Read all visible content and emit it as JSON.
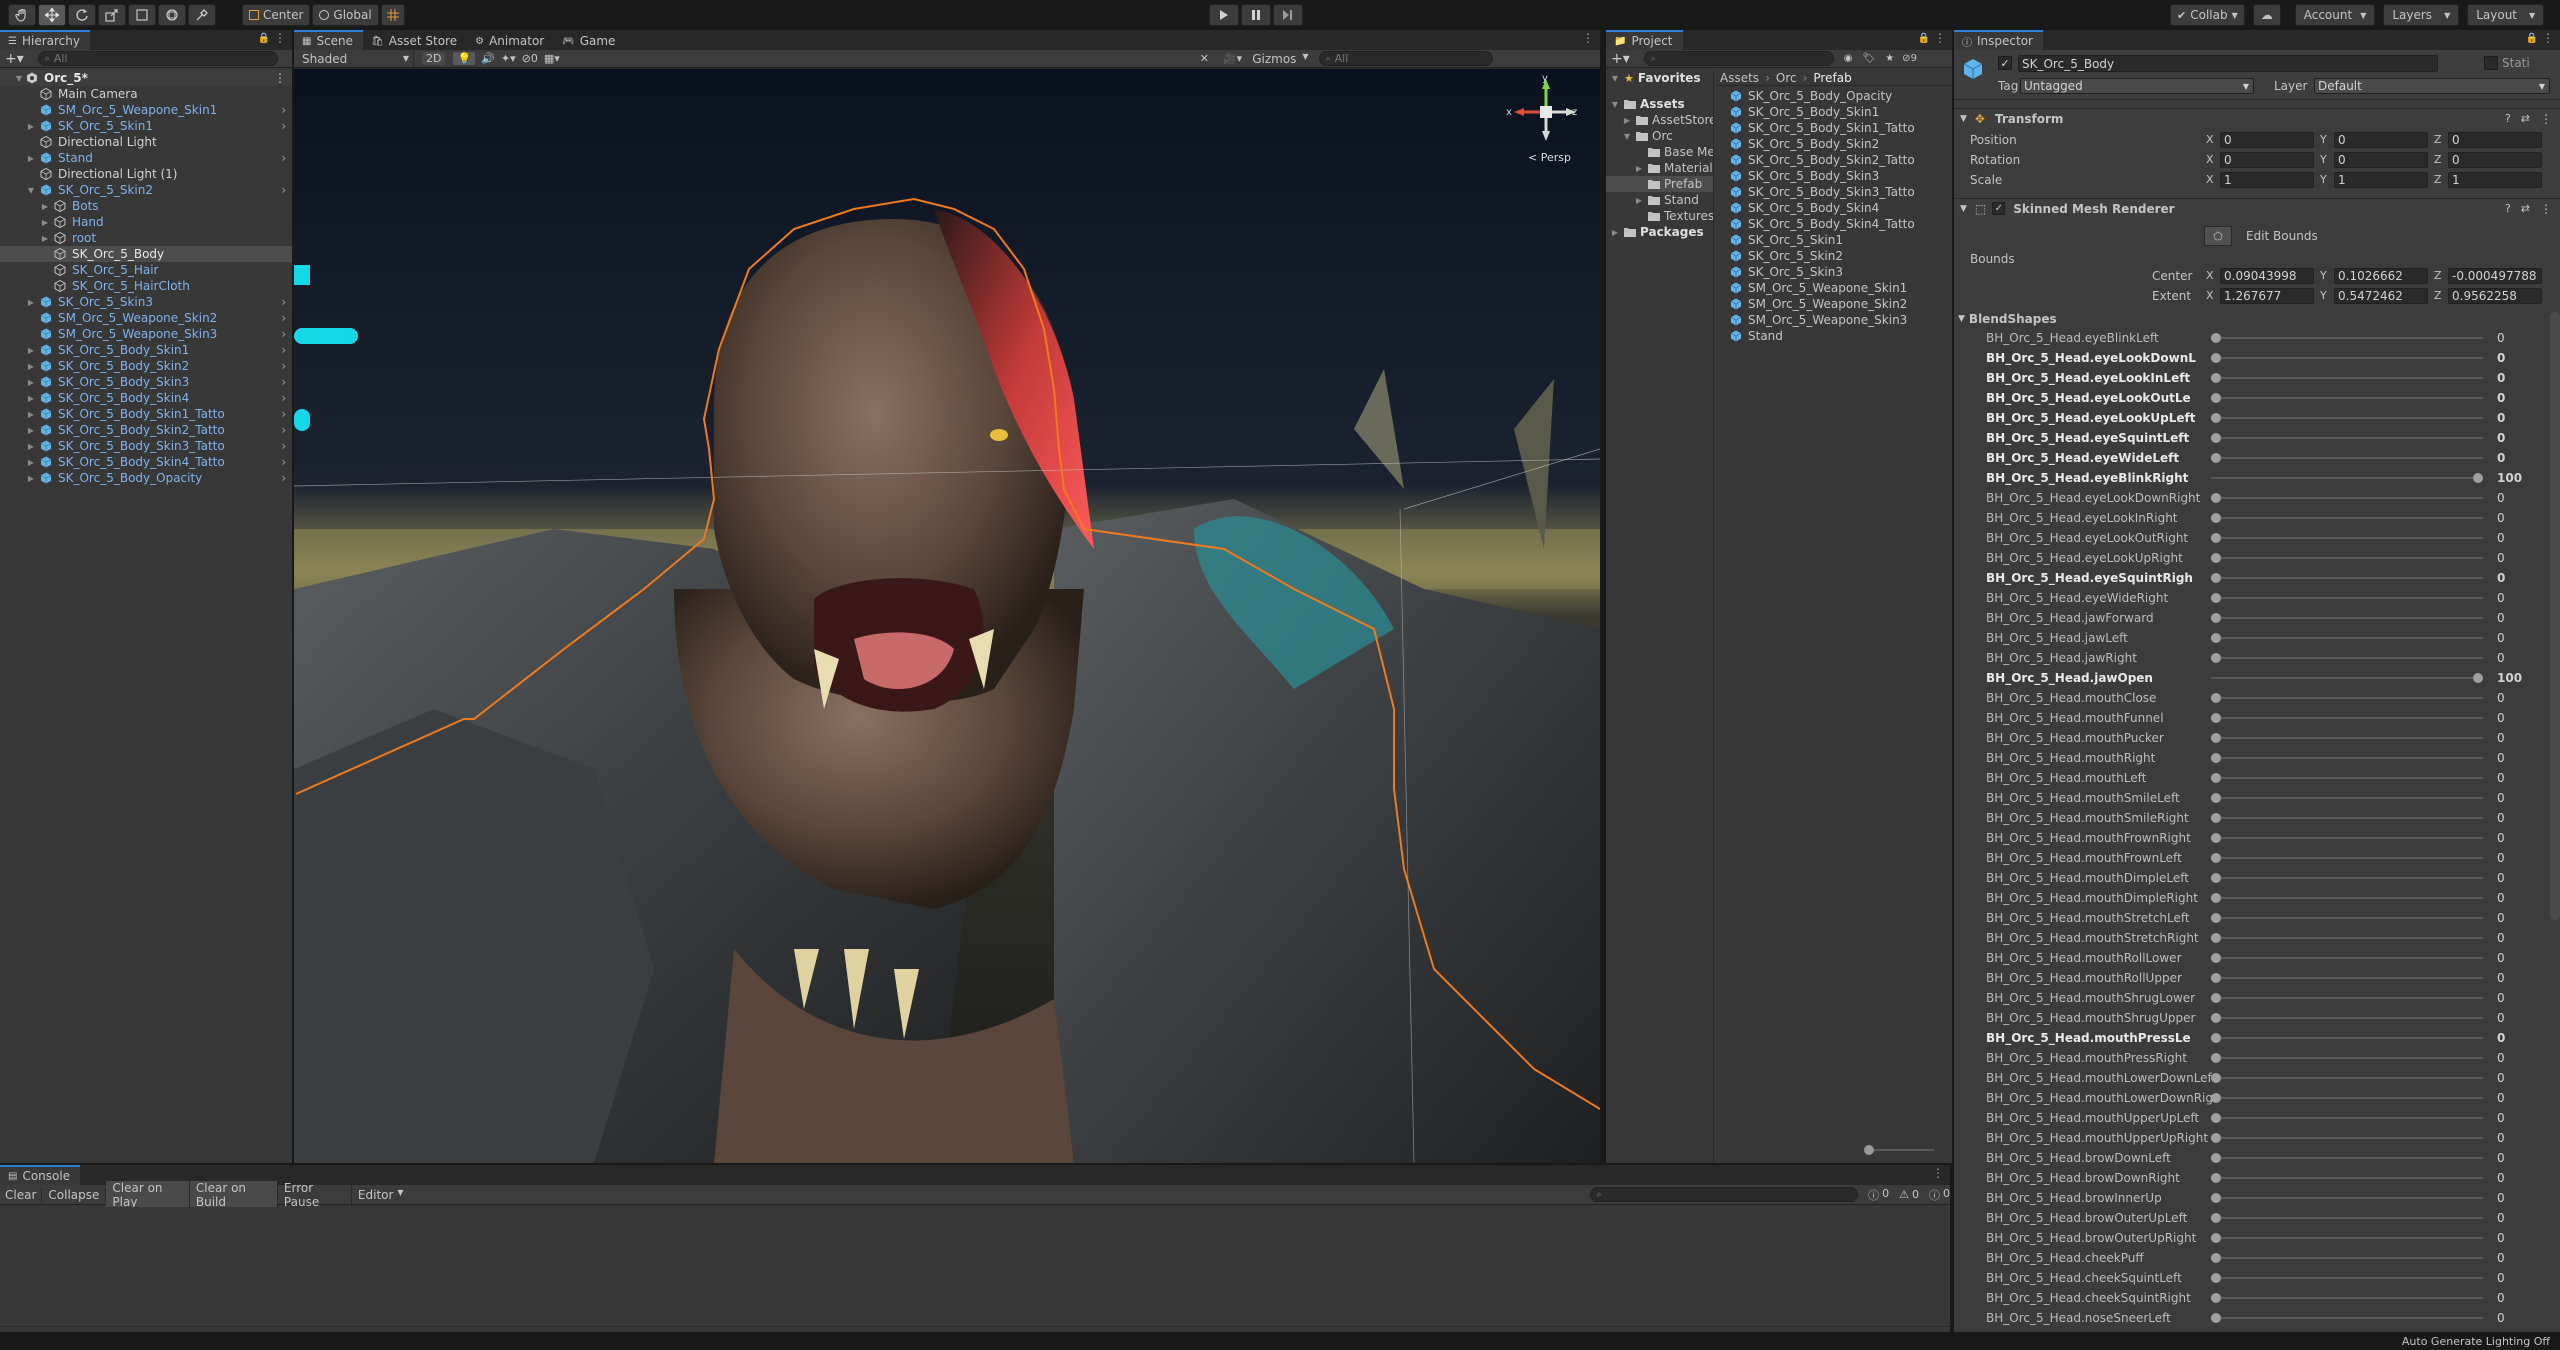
{
  "toolbar": {
    "pivot": "Center",
    "space": "Global",
    "collab": "Collab",
    "account": "Account",
    "layers": "Layers",
    "layout": "Layout"
  },
  "hierarchy": {
    "tab": "Hierarchy",
    "search": "All",
    "items": [
      {
        "label": "Orc_5*",
        "indent": 0,
        "arrow": "down",
        "icon": "scene",
        "style": "scene"
      },
      {
        "label": "Main Camera",
        "indent": 1,
        "arrow": "",
        "icon": "gameobject",
        "style": "plain"
      },
      {
        "label": "SM_Orc_5_Weapone_Skin1",
        "indent": 1,
        "arrow": "",
        "icon": "prefab",
        "style": "blue",
        "more": true
      },
      {
        "label": "SK_Orc_5_Skin1",
        "indent": 1,
        "arrow": "right",
        "icon": "prefab",
        "style": "blue",
        "more": true
      },
      {
        "label": "Directional Light",
        "indent": 1,
        "arrow": "",
        "icon": "gameobject",
        "style": "plain"
      },
      {
        "label": "Stand",
        "indent": 1,
        "arrow": "right",
        "icon": "prefab",
        "style": "blue",
        "more": true
      },
      {
        "label": "Directional Light (1)",
        "indent": 1,
        "arrow": "",
        "icon": "gameobject",
        "style": "plain"
      },
      {
        "label": "SK_Orc_5_Skin2",
        "indent": 1,
        "arrow": "down",
        "icon": "prefab",
        "style": "blue",
        "more": true
      },
      {
        "label": "Bots",
        "indent": 2,
        "arrow": "right",
        "icon": "gameobject",
        "style": "blue"
      },
      {
        "label": "Hand",
        "indent": 2,
        "arrow": "right",
        "icon": "gameobject",
        "style": "blue"
      },
      {
        "label": "root",
        "indent": 2,
        "arrow": "right",
        "icon": "gameobject",
        "style": "blue"
      },
      {
        "label": "SK_Orc_5_Body",
        "indent": 2,
        "arrow": "",
        "icon": "gameobject",
        "style": "selected"
      },
      {
        "label": "SK_Orc_5_Hair",
        "indent": 2,
        "arrow": "",
        "icon": "gameobject",
        "style": "blue"
      },
      {
        "label": "SK_Orc_5_HairCloth",
        "indent": 2,
        "arrow": "",
        "icon": "gameobject",
        "style": "blue"
      },
      {
        "label": "SK_Orc_5_Skin3",
        "indent": 1,
        "arrow": "right",
        "icon": "prefab",
        "style": "blue",
        "more": true
      },
      {
        "label": "SM_Orc_5_Weapone_Skin2",
        "indent": 1,
        "arrow": "",
        "icon": "prefab",
        "style": "blue",
        "more": true
      },
      {
        "label": "SM_Orc_5_Weapone_Skin3",
        "indent": 1,
        "arrow": "",
        "icon": "prefab",
        "style": "blue",
        "more": true
      },
      {
        "label": "SK_Orc_5_Body_Skin1",
        "indent": 1,
        "arrow": "right",
        "icon": "prefab",
        "style": "blue",
        "more": true
      },
      {
        "label": "SK_Orc_5_Body_Skin2",
        "indent": 1,
        "arrow": "right",
        "icon": "prefab",
        "style": "blue",
        "more": true
      },
      {
        "label": "SK_Orc_5_Body_Skin3",
        "indent": 1,
        "arrow": "right",
        "icon": "prefab",
        "style": "blue",
        "more": true
      },
      {
        "label": "SK_Orc_5_Body_Skin4",
        "indent": 1,
        "arrow": "right",
        "icon": "prefab",
        "style": "blue",
        "more": true
      },
      {
        "label": "SK_Orc_5_Body_Skin1_Tatto",
        "indent": 1,
        "arrow": "right",
        "icon": "prefab",
        "style": "blue",
        "more": true
      },
      {
        "label": "SK_Orc_5_Body_Skin2_Tatto",
        "indent": 1,
        "arrow": "right",
        "icon": "prefab",
        "style": "blue",
        "more": true
      },
      {
        "label": "SK_Orc_5_Body_Skin3_Tatto",
        "indent": 1,
        "arrow": "right",
        "icon": "prefab",
        "style": "blue",
        "more": true
      },
      {
        "label": "SK_Orc_5_Body_Skin4_Tatto",
        "indent": 1,
        "arrow": "right",
        "icon": "prefab",
        "style": "blue",
        "more": true
      },
      {
        "label": "SK_Orc_5_Body_Opacity",
        "indent": 1,
        "arrow": "right",
        "icon": "prefab",
        "style": "blue",
        "more": true
      }
    ]
  },
  "scene": {
    "tabs": [
      "Scene",
      "Asset Store",
      "Animator",
      "Game"
    ],
    "shading": "Shaded",
    "mode2d": "2D",
    "layers_count": "0",
    "gizmos": "Gizmos",
    "search": "All",
    "axes": {
      "x": "x",
      "y": "y",
      "z": "z"
    },
    "persp": "< Persp"
  },
  "project": {
    "tab": "Project",
    "breadcrumb": [
      "Assets",
      "Orc",
      "Prefab"
    ],
    "hidden_count": "9",
    "tree": [
      {
        "label": "Favorites",
        "indent": 0,
        "arrow": "down",
        "icon": "star",
        "bold": true
      },
      {
        "label": "Assets",
        "indent": 0,
        "arrow": "down",
        "icon": "folder",
        "bold": true
      },
      {
        "label": "AssetStore",
        "indent": 1,
        "arrow": "right",
        "icon": "folder",
        "bold": false
      },
      {
        "label": "Orc",
        "indent": 1,
        "arrow": "down",
        "icon": "folder",
        "bold": false
      },
      {
        "label": "Base Me",
        "indent": 2,
        "arrow": "",
        "icon": "folder",
        "bold": false
      },
      {
        "label": "Material",
        "indent": 2,
        "arrow": "right",
        "icon": "folder",
        "bold": false
      },
      {
        "label": "Prefab",
        "indent": 2,
        "arrow": "",
        "icon": "folder",
        "bold": false,
        "selected": true
      },
      {
        "label": "Stand",
        "indent": 2,
        "arrow": "right",
        "icon": "folder",
        "bold": false
      },
      {
        "label": "Textures",
        "indent": 2,
        "arrow": "",
        "icon": "folder",
        "bold": false
      },
      {
        "label": "Packages",
        "indent": 0,
        "arrow": "right",
        "icon": "folder",
        "bold": true
      }
    ],
    "assets": [
      "SK_Orc_5_Body_Opacity",
      "SK_Orc_5_Body_Skin1",
      "SK_Orc_5_Body_Skin1_Tatto",
      "SK_Orc_5_Body_Skin2",
      "SK_Orc_5_Body_Skin2_Tatto",
      "SK_Orc_5_Body_Skin3",
      "SK_Orc_5_Body_Skin3_Tatto",
      "SK_Orc_5_Body_Skin4",
      "SK_Orc_5_Body_Skin4_Tatto",
      "SK_Orc_5_Skin1",
      "SK_Orc_5_Skin2",
      "SK_Orc_5_Skin3",
      "SM_Orc_5_Weapone_Skin1",
      "SM_Orc_5_Weapone_Skin2",
      "SM_Orc_5_Weapone_Skin3",
      "Stand"
    ]
  },
  "inspector": {
    "tab": "Inspector",
    "object_name": "SK_Orc_5_Body",
    "static_label": "Stati",
    "tag_label": "Tag",
    "tag_value": "Untagged",
    "layer_label": "Layer",
    "layer_value": "Default",
    "transform": {
      "title": "Transform",
      "rows": [
        {
          "label": "Position",
          "x": "0",
          "y": "0",
          "z": "0"
        },
        {
          "label": "Rotation",
          "x": "0",
          "y": "0",
          "z": "0"
        },
        {
          "label": "Scale",
          "x": "1",
          "y": "1",
          "z": "1"
        }
      ]
    },
    "smr": {
      "title": "Skinned Mesh Renderer",
      "edit_bounds": "Edit Bounds",
      "bounds_label": "Bounds",
      "center": {
        "label": "Center",
        "x": "0.09043998",
        "y": "0.1026662",
        "z": "-0.000497788"
      },
      "extent": {
        "label": "Extent",
        "x": "1.267677",
        "y": "0.5472462",
        "z": "0.9562258"
      }
    },
    "blendshapes_title": "BlendShapes",
    "blendshapes": [
      {
        "name": "BH_Orc_5_Head.eyeBlinkLeft",
        "value": 0,
        "bold": false
      },
      {
        "name": "BH_Orc_5_Head.eyeLookDownL",
        "value": 0,
        "bold": true
      },
      {
        "name": "BH_Orc_5_Head.eyeLookInLeft",
        "value": 0,
        "bold": true
      },
      {
        "name": "BH_Orc_5_Head.eyeLookOutLe",
        "value": 0,
        "bold": true
      },
      {
        "name": "BH_Orc_5_Head.eyeLookUpLeft",
        "value": 0,
        "bold": true
      },
      {
        "name": "BH_Orc_5_Head.eyeSquintLeft",
        "value": 0,
        "bold": true
      },
      {
        "name": "BH_Orc_5_Head.eyeWideLeft",
        "value": 0,
        "bold": true
      },
      {
        "name": "BH_Orc_5_Head.eyeBlinkRight",
        "value": 100,
        "bold": true
      },
      {
        "name": "BH_Orc_5_Head.eyeLookDownRight",
        "value": 0,
        "bold": false
      },
      {
        "name": "BH_Orc_5_Head.eyeLookInRight",
        "value": 0,
        "bold": false
      },
      {
        "name": "BH_Orc_5_Head.eyeLookOutRight",
        "value": 0,
        "bold": false
      },
      {
        "name": "BH_Orc_5_Head.eyeLookUpRight",
        "value": 0,
        "bold": false
      },
      {
        "name": "BH_Orc_5_Head.eyeSquintRigh",
        "value": 0,
        "bold": true
      },
      {
        "name": "BH_Orc_5_Head.eyeWideRight",
        "value": 0,
        "bold": false
      },
      {
        "name": "BH_Orc_5_Head.jawForward",
        "value": 0,
        "bold": false
      },
      {
        "name": "BH_Orc_5_Head.jawLeft",
        "value": 0,
        "bold": false
      },
      {
        "name": "BH_Orc_5_Head.jawRight",
        "value": 0,
        "bold": false
      },
      {
        "name": "BH_Orc_5_Head.jawOpen",
        "value": 100,
        "bold": true
      },
      {
        "name": "BH_Orc_5_Head.mouthClose",
        "value": 0,
        "bold": false
      },
      {
        "name": "BH_Orc_5_Head.mouthFunnel",
        "value": 0,
        "bold": false
      },
      {
        "name": "BH_Orc_5_Head.mouthPucker",
        "value": 0,
        "bold": false
      },
      {
        "name": "BH_Orc_5_Head.mouthRight",
        "value": 0,
        "bold": false
      },
      {
        "name": "BH_Orc_5_Head.mouthLeft",
        "value": 0,
        "bold": false
      },
      {
        "name": "BH_Orc_5_Head.mouthSmileLeft",
        "value": 0,
        "bold": false
      },
      {
        "name": "BH_Orc_5_Head.mouthSmileRight",
        "value": 0,
        "bold": false
      },
      {
        "name": "BH_Orc_5_Head.mouthFrownRight",
        "value": 0,
        "bold": false
      },
      {
        "name": "BH_Orc_5_Head.mouthFrownLeft",
        "value": 0,
        "bold": false
      },
      {
        "name": "BH_Orc_5_Head.mouthDimpleLeft",
        "value": 0,
        "bold": false
      },
      {
        "name": "BH_Orc_5_Head.mouthDimpleRight",
        "value": 0,
        "bold": false
      },
      {
        "name": "BH_Orc_5_Head.mouthStretchLeft",
        "value": 0,
        "bold": false
      },
      {
        "name": "BH_Orc_5_Head.mouthStretchRight",
        "value": 0,
        "bold": false
      },
      {
        "name": "BH_Orc_5_Head.mouthRollLower",
        "value": 0,
        "bold": false
      },
      {
        "name": "BH_Orc_5_Head.mouthRollUpper",
        "value": 0,
        "bold": false
      },
      {
        "name": "BH_Orc_5_Head.mouthShrugLower",
        "value": 0,
        "bold": false
      },
      {
        "name": "BH_Orc_5_Head.mouthShrugUpper",
        "value": 0,
        "bold": false
      },
      {
        "name": "BH_Orc_5_Head.mouthPressLe",
        "value": 0,
        "bold": true
      },
      {
        "name": "BH_Orc_5_Head.mouthPressRight",
        "value": 0,
        "bold": false
      },
      {
        "name": "BH_Orc_5_Head.mouthLowerDownLef",
        "value": 0,
        "bold": false
      },
      {
        "name": "BH_Orc_5_Head.mouthLowerDownRig",
        "value": 0,
        "bold": false
      },
      {
        "name": "BH_Orc_5_Head.mouthUpperUpLeft",
        "value": 0,
        "bold": false
      },
      {
        "name": "BH_Orc_5_Head.mouthUpperUpRight",
        "value": 0,
        "bold": false
      },
      {
        "name": "BH_Orc_5_Head.browDownLeft",
        "value": 0,
        "bold": false
      },
      {
        "name": "BH_Orc_5_Head.browDownRight",
        "value": 0,
        "bold": false
      },
      {
        "name": "BH_Orc_5_Head.browInnerUp",
        "value": 0,
        "bold": false
      },
      {
        "name": "BH_Orc_5_Head.browOuterUpLeft",
        "value": 0,
        "bold": false
      },
      {
        "name": "BH_Orc_5_Head.browOuterUpRight",
        "value": 0,
        "bold": false
      },
      {
        "name": "BH_Orc_5_Head.cheekPuff",
        "value": 0,
        "bold": false
      },
      {
        "name": "BH_Orc_5_Head.cheekSquintLeft",
        "value": 0,
        "bold": false
      },
      {
        "name": "BH_Orc_5_Head.cheekSquintRight",
        "value": 0,
        "bold": false
      },
      {
        "name": "BH_Orc_5_Head.noseSneerLeft",
        "value": 0,
        "bold": false
      }
    ]
  },
  "console": {
    "tab": "Console",
    "buttons": [
      "Clear",
      "Collapse",
      "Clear on Play",
      "Clear on Build",
      "Error Pause",
      "Editor"
    ],
    "log_count": "0",
    "warn_count": "0",
    "error_count": "0"
  },
  "status": {
    "text": "Auto Generate Lighting Off"
  },
  "colors": {
    "accent": "#2f7fd6",
    "selection_outline": "#f07a1e",
    "prefab_text": "#7fb2ee",
    "prefab_icon": "#5fb3ea"
  }
}
